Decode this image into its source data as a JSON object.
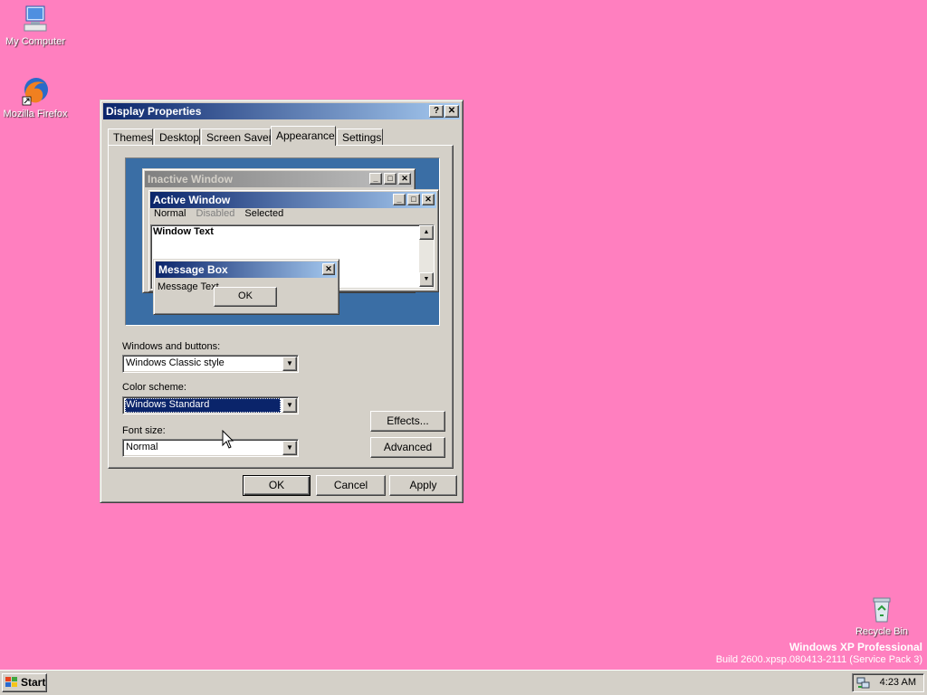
{
  "desktop": {
    "icons": {
      "my_computer": "My Computer",
      "firefox": "Mozilla Firefox",
      "recycle_bin": "Recycle Bin"
    },
    "background_color": "#ff7fbf",
    "os_edition": "Windows XP Professional",
    "build_info": "Build 2600.xpsp.080413-2111 (Service Pack 3)"
  },
  "dialog": {
    "title": "Display Properties",
    "help_button": "?",
    "close_button": "✕",
    "tabs": [
      "Themes",
      "Desktop",
      "Screen Saver",
      "Appearance",
      "Settings"
    ],
    "active_tab": "Appearance",
    "preview": {
      "inactive_title": "Inactive Window",
      "active_title": "Active Window",
      "menu": {
        "normal": "Normal",
        "disabled": "Disabled",
        "selected": "Selected"
      },
      "window_text": "Window Text",
      "msgbox_title": "Message Box",
      "msgbox_text": "Message Text",
      "msgbox_ok": "OK"
    },
    "windows_buttons_label": "Windows and buttons:",
    "windows_buttons_value": "Windows Classic style",
    "color_scheme_label": "Color scheme:",
    "color_scheme_value": "Windows Standard",
    "font_size_label": "Font size:",
    "font_size_value": "Normal",
    "effects_button": "Effects...",
    "advanced_button": "Advanced",
    "ok_button": "OK",
    "cancel_button": "Cancel",
    "apply_button": "Apply"
  },
  "taskbar": {
    "start_label": "Start",
    "clock": "4:23 AM"
  }
}
